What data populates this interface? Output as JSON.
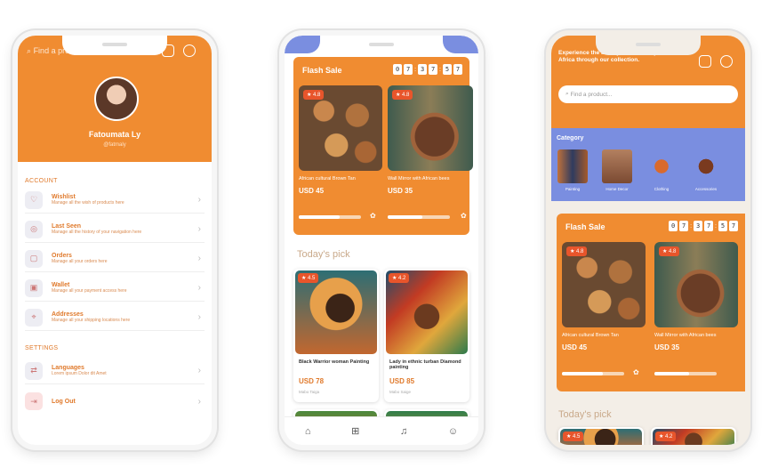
{
  "phone1": {
    "search_placeholder": "Find a product...",
    "user_name": "Fatoumata Ly",
    "user_handle": "@fatmaly",
    "section_account": "ACCOUNT",
    "section_settings": "SETTINGS",
    "items": [
      {
        "label": "Wishlist",
        "desc": "Manage all the wish of products here",
        "icon": "heart-icon"
      },
      {
        "label": "Last Seen",
        "desc": "Manage all the history of your navigation here",
        "icon": "eye-icon"
      },
      {
        "label": "Orders",
        "desc": "Manage all your orders here",
        "icon": "bag-icon"
      },
      {
        "label": "Wallet",
        "desc": "Manage all your payment access here",
        "icon": "wallet-icon"
      },
      {
        "label": "Addresses",
        "desc": "Manage all your shipping locations here",
        "icon": "location-icon"
      }
    ],
    "settings": [
      {
        "label": "Languages",
        "desc": "Lorem ipsum Dolor dit Amet",
        "icon": "language-icon"
      },
      {
        "label": "Log Out",
        "desc": "",
        "icon": "logout-icon"
      }
    ]
  },
  "phone2": {
    "flash_sale": "Flash Sale",
    "timer": [
      "0",
      "7",
      "3",
      "7",
      "5",
      "7"
    ],
    "products": [
      {
        "rating": "4.8",
        "name": "African cultural Brown Tan",
        "price": "USD 45",
        "progress": 0.65
      },
      {
        "rating": "4.8",
        "name": "Wall Mirror with African bees",
        "price": "USD 35",
        "progress": 0.55
      }
    ],
    "todays_pick": "Today's pick",
    "picks": [
      {
        "rating": "4.5",
        "name": "Black Warrior woman Painting",
        "price": "USD 78",
        "creator": "Mabo Taiga"
      },
      {
        "rating": "4.2",
        "name": "Lady in ethnic turban Diamond painting",
        "price": "USD 85",
        "creator": "Mabo Saige"
      }
    ],
    "tabs": [
      "home-icon",
      "grid-icon",
      "bell-icon",
      "user-icon"
    ]
  },
  "phone3": {
    "headline": "Experience the beauty and diversity of Africa through our collection.",
    "search_placeholder": "Find a product...",
    "category_title": "Category",
    "categories": [
      "Painting",
      "Home Decor",
      "Clothing",
      "Accessories"
    ],
    "flash_sale": "Flash Sale",
    "timer": [
      "0",
      "7",
      "3",
      "7",
      "5",
      "7"
    ],
    "products": [
      {
        "rating": "4.8",
        "name": "African cultural Brown Tan",
        "price": "USD 45",
        "progress": 0.65
      },
      {
        "rating": "4.8",
        "name": "Wall Mirror with African bees",
        "price": "USD 35",
        "progress": 0.55
      }
    ],
    "todays_pick": "Today's pick",
    "picks_ratings": [
      "4.5",
      "4.2"
    ]
  },
  "colors": {
    "orange": "#f08c31",
    "blue": "#7a8ee0"
  }
}
